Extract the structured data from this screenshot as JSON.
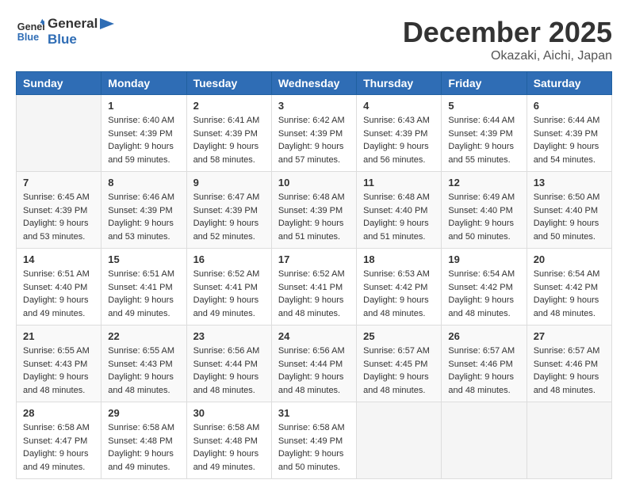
{
  "header": {
    "logo_line1": "General",
    "logo_line2": "Blue",
    "month_title": "December 2025",
    "location": "Okazaki, Aichi, Japan"
  },
  "days_of_week": [
    "Sunday",
    "Monday",
    "Tuesday",
    "Wednesday",
    "Thursday",
    "Friday",
    "Saturday"
  ],
  "weeks": [
    [
      {
        "day": "",
        "sunrise": "",
        "sunset": "",
        "daylight": ""
      },
      {
        "day": "1",
        "sunrise": "Sunrise: 6:40 AM",
        "sunset": "Sunset: 4:39 PM",
        "daylight": "Daylight: 9 hours and 59 minutes."
      },
      {
        "day": "2",
        "sunrise": "Sunrise: 6:41 AM",
        "sunset": "Sunset: 4:39 PM",
        "daylight": "Daylight: 9 hours and 58 minutes."
      },
      {
        "day": "3",
        "sunrise": "Sunrise: 6:42 AM",
        "sunset": "Sunset: 4:39 PM",
        "daylight": "Daylight: 9 hours and 57 minutes."
      },
      {
        "day": "4",
        "sunrise": "Sunrise: 6:43 AM",
        "sunset": "Sunset: 4:39 PM",
        "daylight": "Daylight: 9 hours and 56 minutes."
      },
      {
        "day": "5",
        "sunrise": "Sunrise: 6:44 AM",
        "sunset": "Sunset: 4:39 PM",
        "daylight": "Daylight: 9 hours and 55 minutes."
      },
      {
        "day": "6",
        "sunrise": "Sunrise: 6:44 AM",
        "sunset": "Sunset: 4:39 PM",
        "daylight": "Daylight: 9 hours and 54 minutes."
      }
    ],
    [
      {
        "day": "7",
        "sunrise": "Sunrise: 6:45 AM",
        "sunset": "Sunset: 4:39 PM",
        "daylight": "Daylight: 9 hours and 53 minutes."
      },
      {
        "day": "8",
        "sunrise": "Sunrise: 6:46 AM",
        "sunset": "Sunset: 4:39 PM",
        "daylight": "Daylight: 9 hours and 53 minutes."
      },
      {
        "day": "9",
        "sunrise": "Sunrise: 6:47 AM",
        "sunset": "Sunset: 4:39 PM",
        "daylight": "Daylight: 9 hours and 52 minutes."
      },
      {
        "day": "10",
        "sunrise": "Sunrise: 6:48 AM",
        "sunset": "Sunset: 4:39 PM",
        "daylight": "Daylight: 9 hours and 51 minutes."
      },
      {
        "day": "11",
        "sunrise": "Sunrise: 6:48 AM",
        "sunset": "Sunset: 4:40 PM",
        "daylight": "Daylight: 9 hours and 51 minutes."
      },
      {
        "day": "12",
        "sunrise": "Sunrise: 6:49 AM",
        "sunset": "Sunset: 4:40 PM",
        "daylight": "Daylight: 9 hours and 50 minutes."
      },
      {
        "day": "13",
        "sunrise": "Sunrise: 6:50 AM",
        "sunset": "Sunset: 4:40 PM",
        "daylight": "Daylight: 9 hours and 50 minutes."
      }
    ],
    [
      {
        "day": "14",
        "sunrise": "Sunrise: 6:51 AM",
        "sunset": "Sunset: 4:40 PM",
        "daylight": "Daylight: 9 hours and 49 minutes."
      },
      {
        "day": "15",
        "sunrise": "Sunrise: 6:51 AM",
        "sunset": "Sunset: 4:41 PM",
        "daylight": "Daylight: 9 hours and 49 minutes."
      },
      {
        "day": "16",
        "sunrise": "Sunrise: 6:52 AM",
        "sunset": "Sunset: 4:41 PM",
        "daylight": "Daylight: 9 hours and 49 minutes."
      },
      {
        "day": "17",
        "sunrise": "Sunrise: 6:52 AM",
        "sunset": "Sunset: 4:41 PM",
        "daylight": "Daylight: 9 hours and 48 minutes."
      },
      {
        "day": "18",
        "sunrise": "Sunrise: 6:53 AM",
        "sunset": "Sunset: 4:42 PM",
        "daylight": "Daylight: 9 hours and 48 minutes."
      },
      {
        "day": "19",
        "sunrise": "Sunrise: 6:54 AM",
        "sunset": "Sunset: 4:42 PM",
        "daylight": "Daylight: 9 hours and 48 minutes."
      },
      {
        "day": "20",
        "sunrise": "Sunrise: 6:54 AM",
        "sunset": "Sunset: 4:42 PM",
        "daylight": "Daylight: 9 hours and 48 minutes."
      }
    ],
    [
      {
        "day": "21",
        "sunrise": "Sunrise: 6:55 AM",
        "sunset": "Sunset: 4:43 PM",
        "daylight": "Daylight: 9 hours and 48 minutes."
      },
      {
        "day": "22",
        "sunrise": "Sunrise: 6:55 AM",
        "sunset": "Sunset: 4:43 PM",
        "daylight": "Daylight: 9 hours and 48 minutes."
      },
      {
        "day": "23",
        "sunrise": "Sunrise: 6:56 AM",
        "sunset": "Sunset: 4:44 PM",
        "daylight": "Daylight: 9 hours and 48 minutes."
      },
      {
        "day": "24",
        "sunrise": "Sunrise: 6:56 AM",
        "sunset": "Sunset: 4:44 PM",
        "daylight": "Daylight: 9 hours and 48 minutes."
      },
      {
        "day": "25",
        "sunrise": "Sunrise: 6:57 AM",
        "sunset": "Sunset: 4:45 PM",
        "daylight": "Daylight: 9 hours and 48 minutes."
      },
      {
        "day": "26",
        "sunrise": "Sunrise: 6:57 AM",
        "sunset": "Sunset: 4:46 PM",
        "daylight": "Daylight: 9 hours and 48 minutes."
      },
      {
        "day": "27",
        "sunrise": "Sunrise: 6:57 AM",
        "sunset": "Sunset: 4:46 PM",
        "daylight": "Daylight: 9 hours and 48 minutes."
      }
    ],
    [
      {
        "day": "28",
        "sunrise": "Sunrise: 6:58 AM",
        "sunset": "Sunset: 4:47 PM",
        "daylight": "Daylight: 9 hours and 49 minutes."
      },
      {
        "day": "29",
        "sunrise": "Sunrise: 6:58 AM",
        "sunset": "Sunset: 4:48 PM",
        "daylight": "Daylight: 9 hours and 49 minutes."
      },
      {
        "day": "30",
        "sunrise": "Sunrise: 6:58 AM",
        "sunset": "Sunset: 4:48 PM",
        "daylight": "Daylight: 9 hours and 49 minutes."
      },
      {
        "day": "31",
        "sunrise": "Sunrise: 6:58 AM",
        "sunset": "Sunset: 4:49 PM",
        "daylight": "Daylight: 9 hours and 50 minutes."
      },
      {
        "day": "",
        "sunrise": "",
        "sunset": "",
        "daylight": ""
      },
      {
        "day": "",
        "sunrise": "",
        "sunset": "",
        "daylight": ""
      },
      {
        "day": "",
        "sunrise": "",
        "sunset": "",
        "daylight": ""
      }
    ]
  ]
}
